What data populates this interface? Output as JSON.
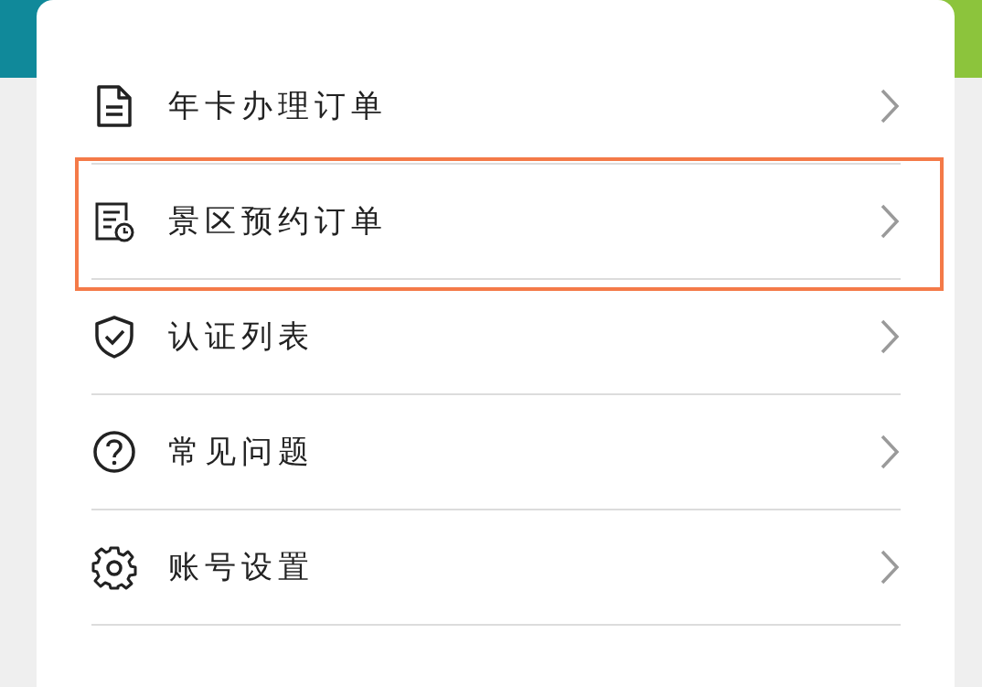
{
  "menu": {
    "items": [
      {
        "label": "年卡办理订单",
        "highlighted": false
      },
      {
        "label": "景区预约订单",
        "highlighted": true
      },
      {
        "label": "认证列表",
        "highlighted": false
      },
      {
        "label": "常见问题",
        "highlighted": false
      },
      {
        "label": "账号设置",
        "highlighted": false
      }
    ]
  }
}
